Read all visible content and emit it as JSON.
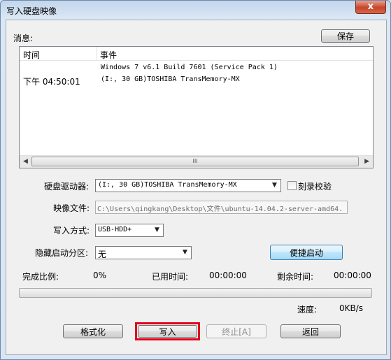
{
  "window": {
    "title": "写入硬盘映像",
    "close_glyph": "x"
  },
  "messages": {
    "label": "消息:",
    "save_label": "保存",
    "columns": [
      "时间",
      "事件"
    ],
    "rows": [
      {
        "time": "下午 04:50:01",
        "event_line1": "Windows 7 v6.1 Build 7601 (Service Pack 1)",
        "event_line2": "(I:, 30 GB)TOSHIBA TransMemory-MX"
      }
    ],
    "scroll_thumb_glyph": "III"
  },
  "drive": {
    "label": "硬盘驱动器:",
    "selected": "(I:, 30 GB)TOSHIBA TransMemory-MX",
    "verify_label": "刻录校验"
  },
  "image_file": {
    "label": "映像文件:",
    "value": "C:\\Users\\qingkang\\Desktop\\文件\\ubuntu-14.04.2-server-amd64."
  },
  "write_method": {
    "label": "写入方式:",
    "selected": "USB-HDD+"
  },
  "hidden_partition": {
    "label": "隐藏启动分区:",
    "selected": "无"
  },
  "quick_boot_label": "便捷启动",
  "status": {
    "progress_label": "完成比例:",
    "progress_value": "0%",
    "elapsed_label": "已用时间:",
    "elapsed_value": "00:00:00",
    "remaining_label": "剩余时间:",
    "remaining_value": "00:00:00",
    "speed_label": "速度:",
    "speed_value": "0KB/s",
    "progress_fraction": 0
  },
  "buttons": {
    "format": "格式化",
    "write": "写入",
    "abort": "终止[A]",
    "back": "返回"
  },
  "colors": {
    "highlight": "#e0001a"
  }
}
